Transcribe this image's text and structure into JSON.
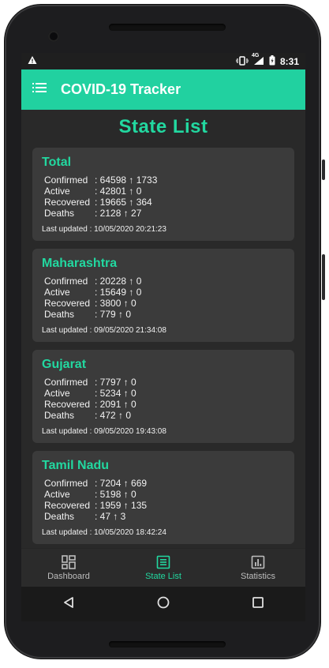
{
  "status_bar": {
    "time": "8:31",
    "network": "4G"
  },
  "app_bar": {
    "title": "COVID-19 Tracker",
    "menu_icon": "menu-icon"
  },
  "page_title": "State List",
  "cards": [
    {
      "name": "Total",
      "rows": [
        {
          "label": "Confirmed",
          "value": ": 64598 ↑ 1733"
        },
        {
          "label": "Active",
          "value": ": 42801 ↑ 0"
        },
        {
          "label": "Recovered",
          "value": ": 19665 ↑ 364"
        },
        {
          "label": "Deaths",
          "value": ": 2128 ↑ 27"
        }
      ],
      "updated": "Last updated : 10/05/2020 20:21:23"
    },
    {
      "name": "Maharashtra",
      "rows": [
        {
          "label": "Confirmed",
          "value": ": 20228 ↑ 0"
        },
        {
          "label": "Active",
          "value": ": 15649 ↑ 0"
        },
        {
          "label": "Recovered",
          "value": ": 3800 ↑ 0"
        },
        {
          "label": "Deaths",
          "value": ": 779 ↑ 0"
        }
      ],
      "updated": "Last updated : 09/05/2020 21:34:08"
    },
    {
      "name": "Gujarat",
      "rows": [
        {
          "label": "Confirmed",
          "value": ": 7797 ↑ 0"
        },
        {
          "label": "Active",
          "value": ": 5234 ↑ 0"
        },
        {
          "label": "Recovered",
          "value": ": 2091 ↑ 0"
        },
        {
          "label": "Deaths",
          "value": ": 472 ↑ 0"
        }
      ],
      "updated": "Last updated : 09/05/2020 19:43:08"
    },
    {
      "name": "Tamil Nadu",
      "rows": [
        {
          "label": "Confirmed",
          "value": ": 7204 ↑ 669"
        },
        {
          "label": "Active",
          "value": ": 5198 ↑ 0"
        },
        {
          "label": "Recovered",
          "value": ": 1959 ↑ 135"
        },
        {
          "label": "Deaths",
          "value": ": 47 ↑ 3"
        }
      ],
      "updated": "Last updated : 10/05/2020 18:42:24"
    }
  ],
  "bottom_nav": [
    {
      "label": "Dashboard",
      "icon": "dashboard-icon",
      "active": false
    },
    {
      "label": "State List",
      "icon": "list-icon",
      "active": true
    },
    {
      "label": "Statistics",
      "icon": "chart-icon",
      "active": false
    }
  ],
  "colors": {
    "accent": "#21d1a0",
    "background": "#292929",
    "card": "#3b3b3b"
  }
}
